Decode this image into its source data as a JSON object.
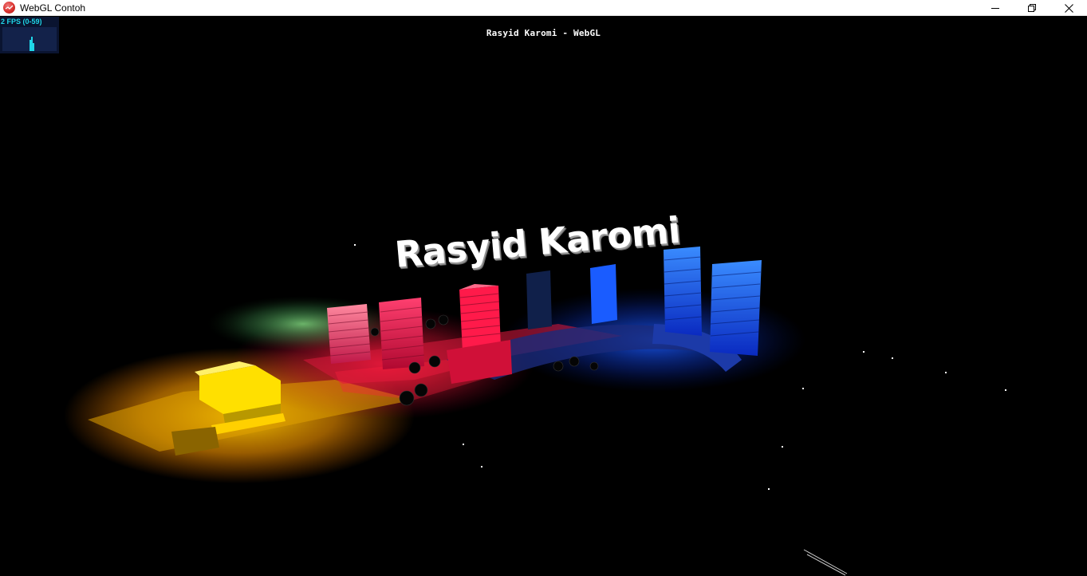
{
  "window": {
    "title": "WebGL Contoh",
    "icon": "webgl-app-icon",
    "controls": {
      "minimize_icon": "minimize-icon",
      "maximize_icon": "restore-icon",
      "close_icon": "close-icon"
    }
  },
  "stats": {
    "label": "2 FPS (0-59)",
    "color": "#1fd6e8",
    "background": "#0a1430"
  },
  "info": {
    "text": "Rasyid Karomi - WebGL"
  },
  "scene": {
    "text3d": "Rasyid Karomi",
    "light_colors": [
      "#ffe000",
      "#ff8a00",
      "#ff1a3c",
      "#e0185a",
      "#2a8cff",
      "#0a3cff",
      "#40c060"
    ],
    "background": "#000000"
  }
}
